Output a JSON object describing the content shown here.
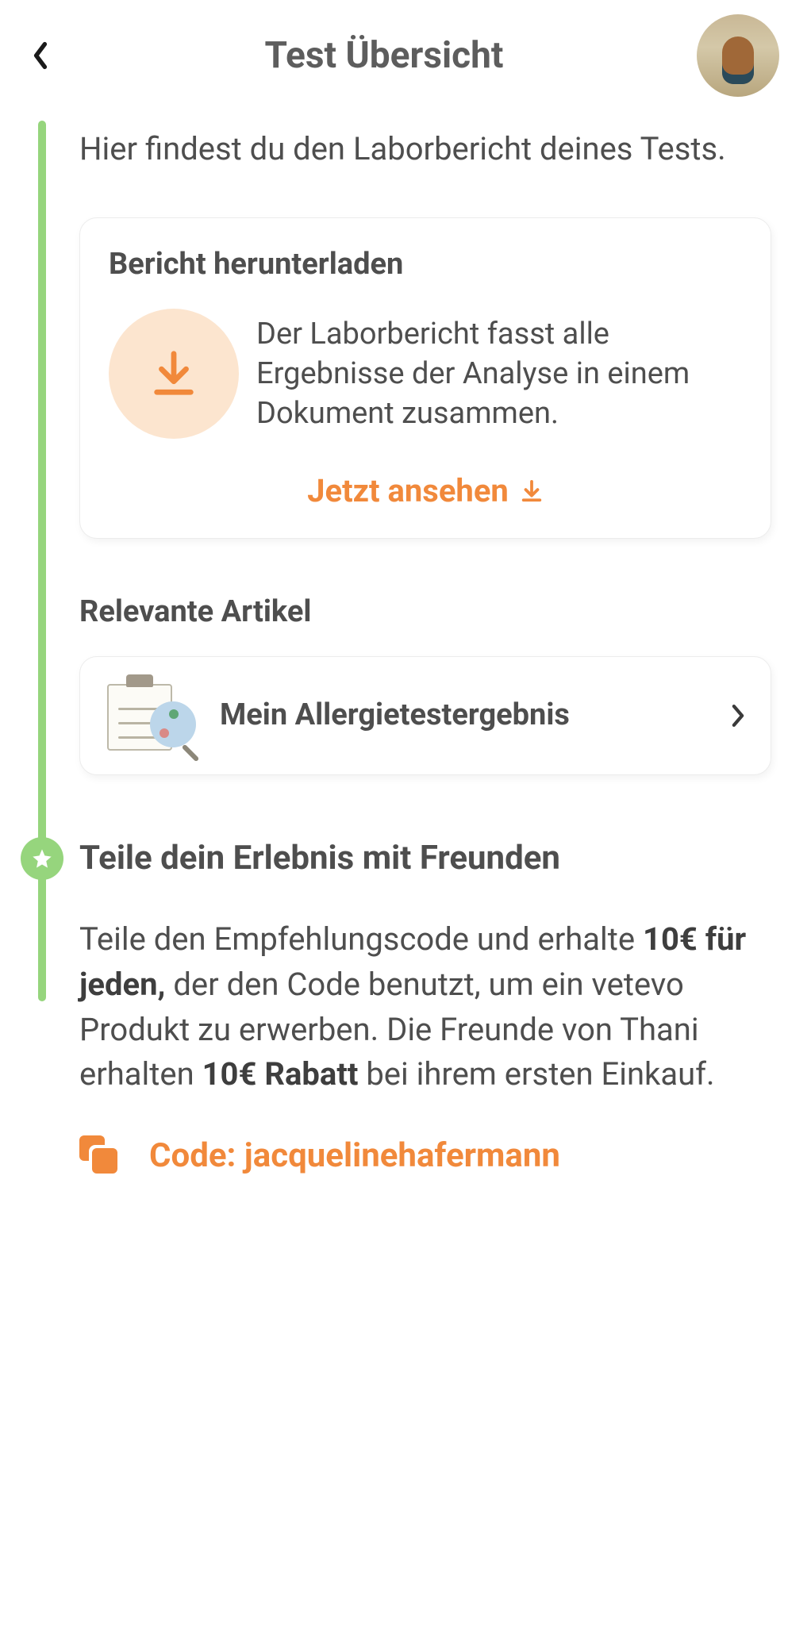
{
  "header": {
    "title": "Test Übersicht"
  },
  "intro": "Hier findest du den Laborbericht deines Tests.",
  "download_card": {
    "title": "Bericht herunterladen",
    "description": "Der Laborbericht fasst alle Ergebnisse der Analyse in einem Dokument zusammen.",
    "cta": "Jetzt ansehen"
  },
  "articles": {
    "section_title": "Relevante Artikel",
    "items": [
      {
        "title": "Mein Allergietestergebnis"
      }
    ]
  },
  "share": {
    "title": "Teile dein Erlebnis mit Freunden",
    "text_prefix": "Teile den Empfehlungscode und erhalte ",
    "bold1": "10€ für jeden,",
    "text_mid": " der den Code benutzt, um ein vetevo Produkt zu erwerben. Die Freunde von Thani  erhalten ",
    "bold2": "10€ Rabatt",
    "text_suffix": " bei ihrem ersten Einkauf.",
    "code_label": "Code: jacquelinehafermann"
  },
  "colors": {
    "accent": "#f1893b",
    "timeline": "#96d57d"
  }
}
